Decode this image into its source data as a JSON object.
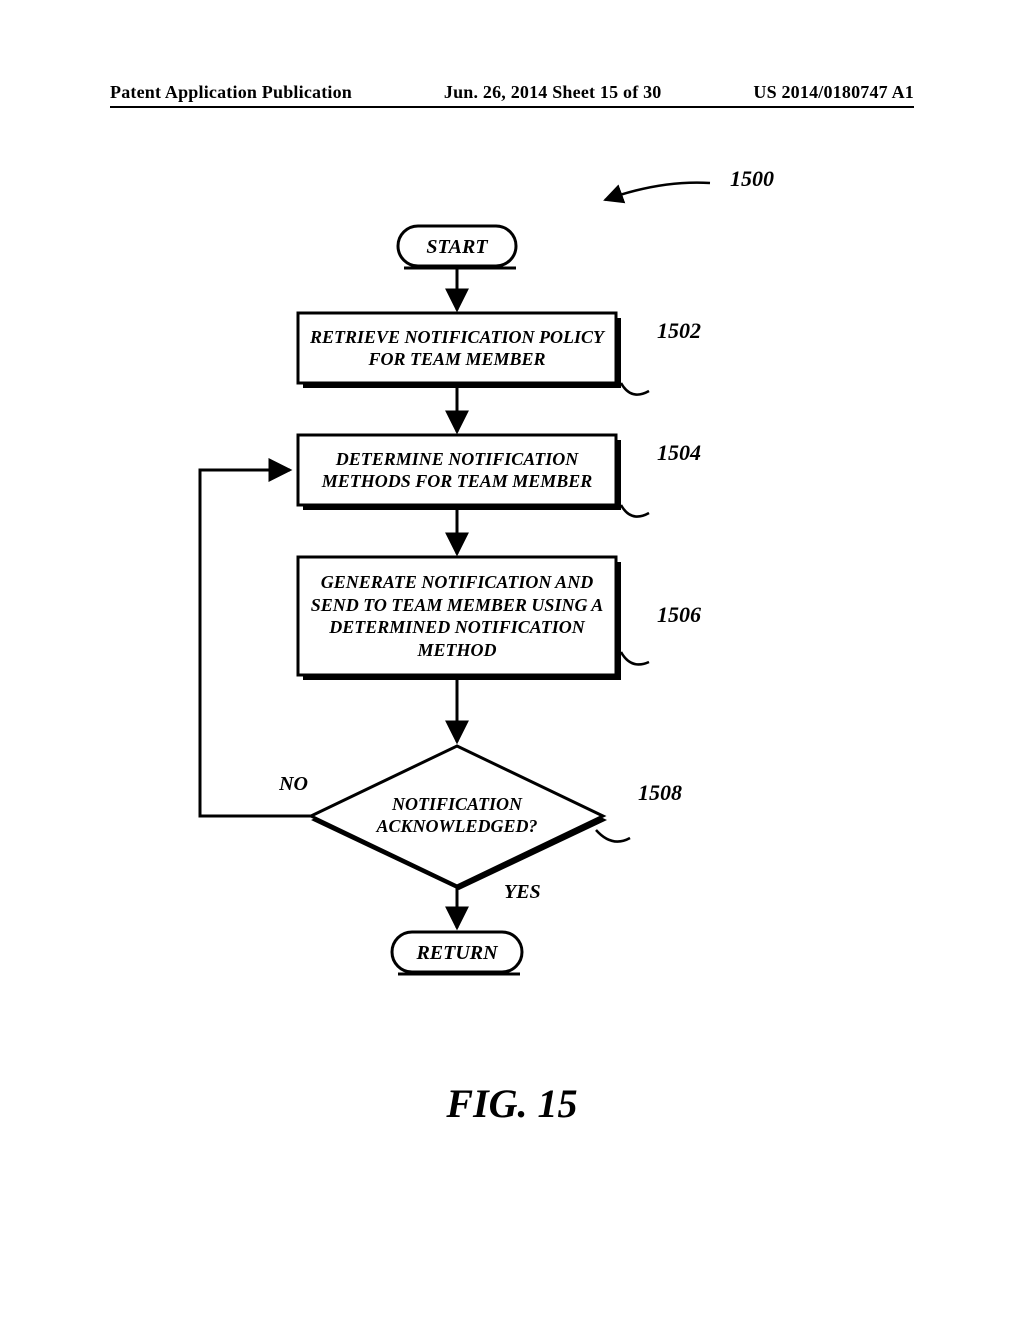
{
  "header": {
    "left": "Patent Application Publication",
    "center": "Jun. 26, 2014  Sheet 15 of 30",
    "right": "US 2014/0180747 A1"
  },
  "diagram": {
    "ref_number": "1500",
    "start": "START",
    "return": "RETURN",
    "boxes": {
      "b1502": {
        "text": "RETRIEVE NOTIFICATION POLICY FOR TEAM MEMBER",
        "ref": "1502"
      },
      "b1504": {
        "text": "DETERMINE NOTIFICATION METHODS FOR TEAM MEMBER",
        "ref": "1504"
      },
      "b1506": {
        "text": "GENERATE NOTIFICATION AND SEND TO TEAM MEMBER USING A DETERMINED NOTIFICATION METHOD",
        "ref": "1506"
      }
    },
    "decision": {
      "text": "NOTIFICATION ACKNOWLEDGED?",
      "ref": "1508",
      "no": "NO",
      "yes": "YES"
    }
  },
  "figure_caption": "FIG. 15"
}
